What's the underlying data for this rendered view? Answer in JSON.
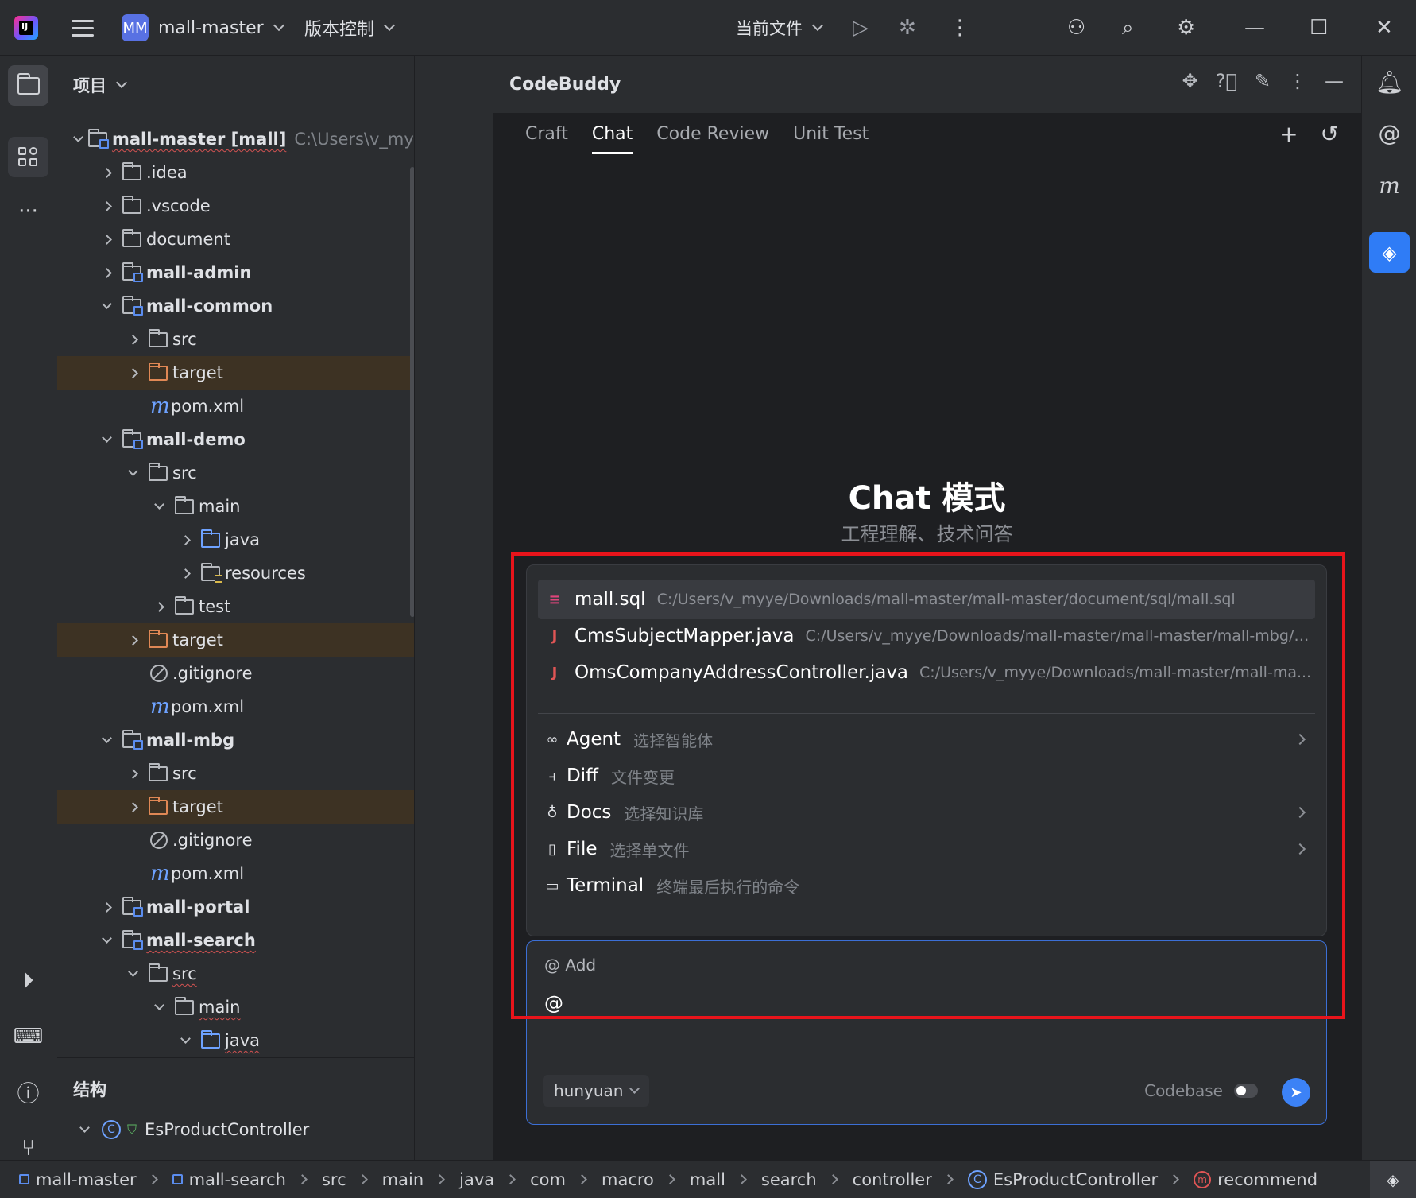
{
  "titlebar": {
    "project_badge": "MM",
    "project_name": "mall-master",
    "vcs_label": "版本控制",
    "run_config": "当前文件"
  },
  "project_panel": {
    "title": "项目",
    "root_name": "mall-master [mall]",
    "root_path": "C:\\Users\\v_myye",
    "items": [
      {
        "label": ".idea"
      },
      {
        "label": ".vscode"
      },
      {
        "label": "document"
      },
      {
        "label": "mall-admin"
      },
      {
        "label": "mall-common"
      },
      {
        "label": "src"
      },
      {
        "label": "target"
      },
      {
        "label": "pom.xml"
      },
      {
        "label": "mall-demo"
      },
      {
        "label": "src"
      },
      {
        "label": "main"
      },
      {
        "label": "java"
      },
      {
        "label": "resources"
      },
      {
        "label": "test"
      },
      {
        "label": "target"
      },
      {
        "label": ".gitignore"
      },
      {
        "label": "pom.xml"
      },
      {
        "label": "mall-mbg"
      },
      {
        "label": "src"
      },
      {
        "label": "target"
      },
      {
        "label": ".gitignore"
      },
      {
        "label": "pom.xml"
      },
      {
        "label": "mall-portal"
      },
      {
        "label": "mall-search"
      },
      {
        "label": "src"
      },
      {
        "label": "main"
      },
      {
        "label": "java"
      }
    ]
  },
  "structure_panel": {
    "title": "结构",
    "class_name": "EsProductController"
  },
  "codebuddy": {
    "title": "CodeBuddy",
    "tabs": [
      "Craft",
      "Chat",
      "Code Review",
      "Unit Test"
    ],
    "active_tab": "Chat",
    "hero_title": "Chat 模式",
    "hero_subtitle": "工程理解、技术问答",
    "files": [
      {
        "name": "mall.sql",
        "path": "C:/Users/v_myye/Downloads/mall-master/mall-master/document/sql/mall.sql"
      },
      {
        "name": "CmsSubjectMapper.java",
        "path": "C:/Users/v_myye/Downloads/mall-master/mall-master/mall-mbg/s..."
      },
      {
        "name": "OmsCompanyAddressController.java",
        "path": "C:/Users/v_myye/Downloads/mall-master/mall-ma..."
      }
    ],
    "commands": [
      {
        "name": "Agent",
        "desc": "选择智能体"
      },
      {
        "name": "Diff",
        "desc": "文件变更"
      },
      {
        "name": "Docs",
        "desc": "选择知识库"
      },
      {
        "name": "File",
        "desc": "选择单文件"
      },
      {
        "name": "Terminal",
        "desc": "终端最后执行的命令"
      }
    ],
    "input": {
      "add_label": "@ Add",
      "value": "@",
      "model": "hunyuan",
      "codebase_label": "Codebase"
    }
  },
  "statusbar": {
    "crumbs": [
      "mall-master",
      "mall-search",
      "src",
      "main",
      "java",
      "com",
      "macro",
      "mall",
      "search",
      "controller",
      "EsProductController",
      "recommend"
    ]
  },
  "colors": {
    "accent": "#3c82f6",
    "highlight_box": "#e8141b",
    "excluded_folder_bg": "#3d3223"
  }
}
